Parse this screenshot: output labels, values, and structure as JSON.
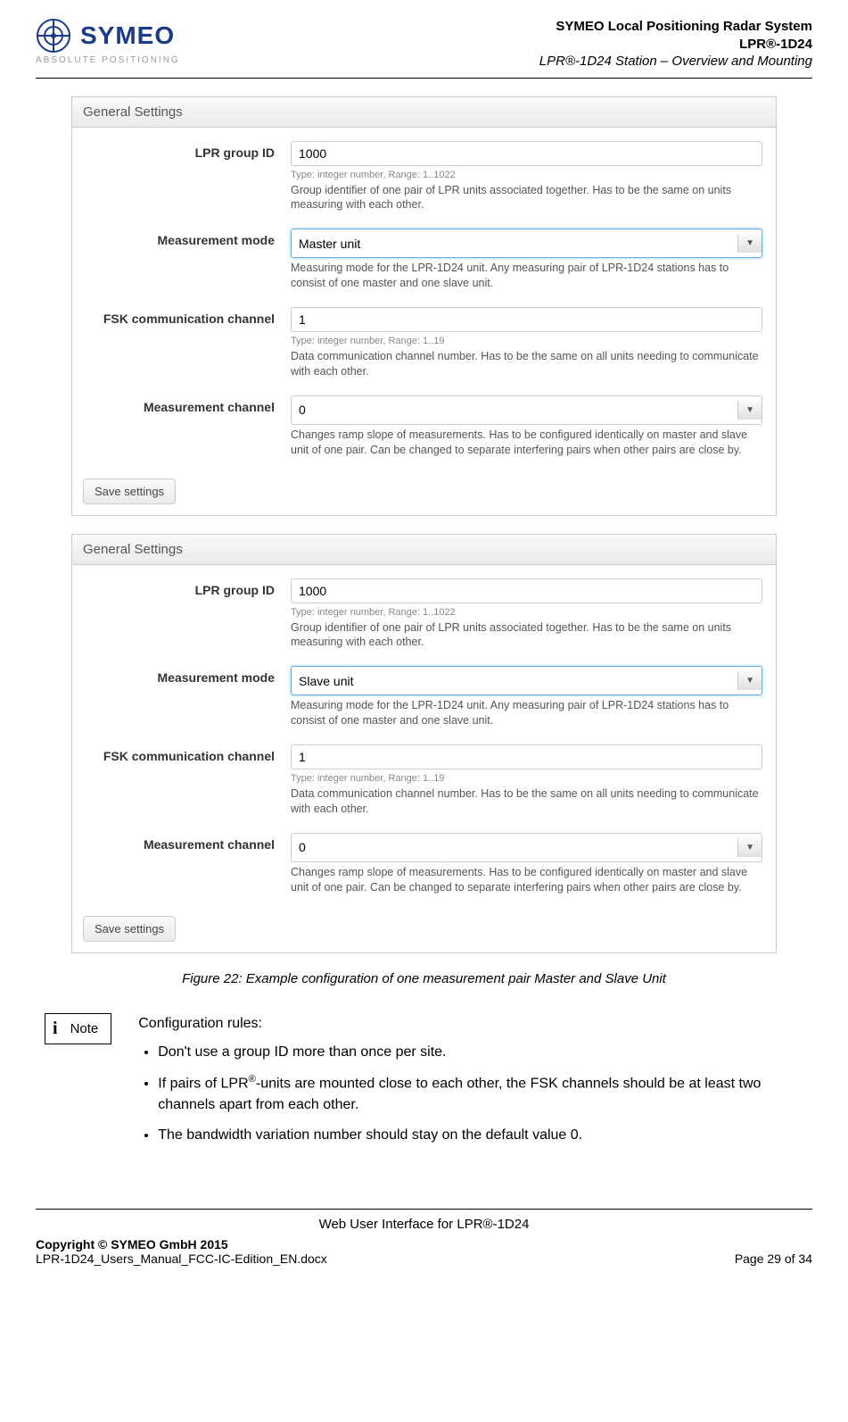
{
  "header": {
    "logo_text": "SYMEO",
    "tagline": "ABSOLUTE POSITIONING",
    "line1": "SYMEO Local Positioning Radar System",
    "line2": "LPR®-1D24",
    "line3": "LPR®-1D24 Station – Overview and Mounting"
  },
  "panels": [
    {
      "title": "General Settings",
      "fields": {
        "group_id": {
          "label": "LPR group ID",
          "value": "1000",
          "hint": "Type: integer number, Range: 1..1022",
          "help": "Group identifier of one pair of LPR units associated together. Has to be the same on units measuring with each other."
        },
        "mode": {
          "label": "Measurement mode",
          "value": "Master unit",
          "help": "Measuring mode for the LPR-1D24 unit. Any measuring pair of LPR-1D24 stations has to consist of one master and one slave unit."
        },
        "fsk": {
          "label": "FSK communication channel",
          "value": "1",
          "hint": "Type: integer number, Range: 1..19",
          "help": "Data communication channel number. Has to be the same on all units needing to communicate with each other."
        },
        "meas_channel": {
          "label": "Measurement channel",
          "value": "0",
          "help": "Changes ramp slope of measurements. Has to be configured identically on master and slave unit of one pair. Can be changed to separate interfering pairs when other pairs are close by."
        }
      },
      "save_label": "Save settings"
    },
    {
      "title": "General Settings",
      "fields": {
        "group_id": {
          "label": "LPR group ID",
          "value": "1000",
          "hint": "Type: integer number, Range: 1..1022",
          "help": "Group identifier of one pair of LPR units associated together. Has to be the same on units measuring with each other."
        },
        "mode": {
          "label": "Measurement mode",
          "value": "Slave unit",
          "help": "Measuring mode for the LPR-1D24 unit. Any measuring pair of LPR-1D24 stations has to consist of one master and one slave unit."
        },
        "fsk": {
          "label": "FSK communication channel",
          "value": "1",
          "hint": "Type: integer number, Range: 1..19",
          "help": "Data communication channel number. Has to be the same on all units needing to communicate with each other."
        },
        "meas_channel": {
          "label": "Measurement channel",
          "value": "0",
          "help": "Changes ramp slope of measurements. Has to be configured identically on master and slave unit of one pair. Can be changed to separate interfering pairs when other pairs are close by."
        }
      },
      "save_label": "Save settings"
    }
  ],
  "figure_caption": "Figure 22: Example configuration of one measurement pair Master and Slave Unit",
  "note": {
    "badge": "Note",
    "title": "Configuration rules:",
    "bullet1": "Don't use a group ID more than once per site.",
    "bullet2a": "If pairs of LPR",
    "bullet2b": "-units are mounted close to each other, the FSK channels should be at least two channels apart from each other.",
    "bullet3": "The bandwidth variation number should stay on the default value 0."
  },
  "footer": {
    "title": "Web User Interface for LPR®-1D24",
    "copyright": "Copyright © SYMEO GmbH 2015",
    "filename": "LPR-1D24_Users_Manual_FCC-IC-Edition_EN.docx",
    "page": "Page 29 of 34"
  }
}
